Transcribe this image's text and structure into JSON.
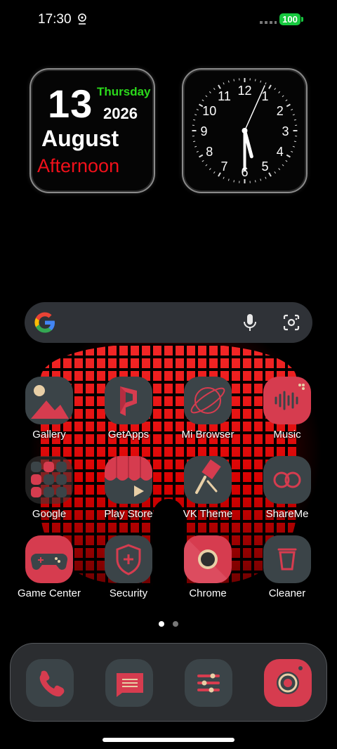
{
  "status_bar": {
    "time": "17:30",
    "battery": "100"
  },
  "date_widget": {
    "day": "13",
    "weekday": "Thursday",
    "year": "2026",
    "month": "August",
    "day_part": "Afternoon"
  },
  "clock_widget": {
    "numbers": [
      "12",
      "1",
      "2",
      "3",
      "4",
      "5",
      "6",
      "7",
      "8",
      "9",
      "10",
      "11"
    ]
  },
  "search_bar": {
    "logo": "G"
  },
  "apps": [
    {
      "label": "Gallery",
      "icon": "gallery-icon"
    },
    {
      "label": "GetApps",
      "icon": "getapps-icon"
    },
    {
      "label": "Mi Browser",
      "icon": "browser-icon"
    },
    {
      "label": "Music",
      "icon": "music-icon"
    },
    {
      "label": "Google",
      "icon": "google-folder-icon"
    },
    {
      "label": "Play Store",
      "icon": "play-store-icon"
    },
    {
      "label": "VK Theme",
      "icon": "theme-brush-icon"
    },
    {
      "label": "ShareMe",
      "icon": "shareme-icon"
    },
    {
      "label": "Game Center",
      "icon": "gamepad-icon"
    },
    {
      "label": "Security",
      "icon": "shield-icon"
    },
    {
      "label": "Chrome",
      "icon": "chrome-icon"
    },
    {
      "label": "Cleaner",
      "icon": "trash-icon"
    }
  ],
  "dock": [
    "phone-icon",
    "messages-icon",
    "settings-icon",
    "camera-icon"
  ],
  "colors": {
    "accent": "#d63c4f",
    "icon_bg": "#3b4448",
    "cream": "#e8cfa6",
    "weekday_green": "#2bd91b",
    "daypart_red": "#f0101a"
  }
}
